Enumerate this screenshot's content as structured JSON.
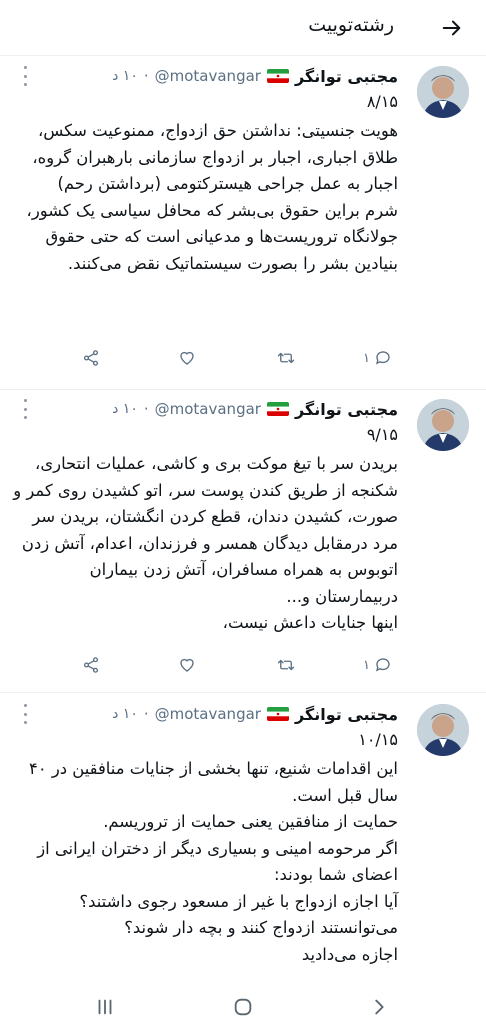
{
  "header": {
    "title": "رشته‌توییت",
    "back_icon": "arrow-right-icon"
  },
  "tweets": [
    {
      "author": "مجتبی توانگر",
      "handle": "@motavangar",
      "time": "۱۰ د",
      "counter": "۸/۱۵",
      "text": "هویت جنسیتی: نداشتن حق ازدواج، ممنوعیت سکس، طلاق اجباری، اجبار بر ازدواج سازمانی بارهبران گروه، اجبار به عمل جراحی هیسترکتومی (برداشتن رحم)\nشرم براین حقوق بی‌بشر که محافل سیاسی یک کشور، جولانگاه تروریست‌ها و مدعیانی است که حتی حقوق بنیادین بشر را بصورت سیستماتیک نقض می‌کنند.",
      "reply_count": "۱"
    },
    {
      "author": "مجتبی توانگر",
      "handle": "@motavangar",
      "time": "۱۰ د",
      "counter": "۹/۱۵",
      "text": "بریدن سر با تیغ موکت بری و کاشی، عملیات انتحاری، شکنجه از طریق کندن پوست سر، اتو کشیدن روی کمر و صورت، کشیدن دندان، قطع کردن انگشتان، بریدن سر مرد درمقابل دیدگان همسر و فرزندان، اعدام، آتش زدن اتوبوس به همراه مسافران، آتش زدن بیماران دربیمارستان و...\nاینها جنایات داعش نیست،",
      "reply_count": "۱"
    },
    {
      "author": "مجتبی توانگر",
      "handle": "@motavangar",
      "time": "۱۰ د",
      "counter": "۱۰/۱۵",
      "text": "این اقدامات شنیع، تنها بخشی از جنایات منافقین در ۴۰ سال قبل است.\nحمایت از منافقین یعنی حمایت از تروریسم.\nاگر  مرحومه امینی و بسیاری دیگر از دختران ایرانی از اعضای شما بودند:\nآیا اجازه ازدواج با غیر از مسعود رجوی داشتند؟\nمی‌توانستند ازدواج کنند و بچه دار شوند؟\nاجازه می‌دادید"
    }
  ],
  "icons": {
    "reply": "reply-icon",
    "retweet": "retweet-icon",
    "like": "heart-icon",
    "share": "share-icon",
    "more": "more-vertical-icon",
    "flag": "iran-flag-icon"
  },
  "navbar": {
    "recent": "recent-apps-icon",
    "home": "home-icon",
    "back": "back-icon"
  }
}
